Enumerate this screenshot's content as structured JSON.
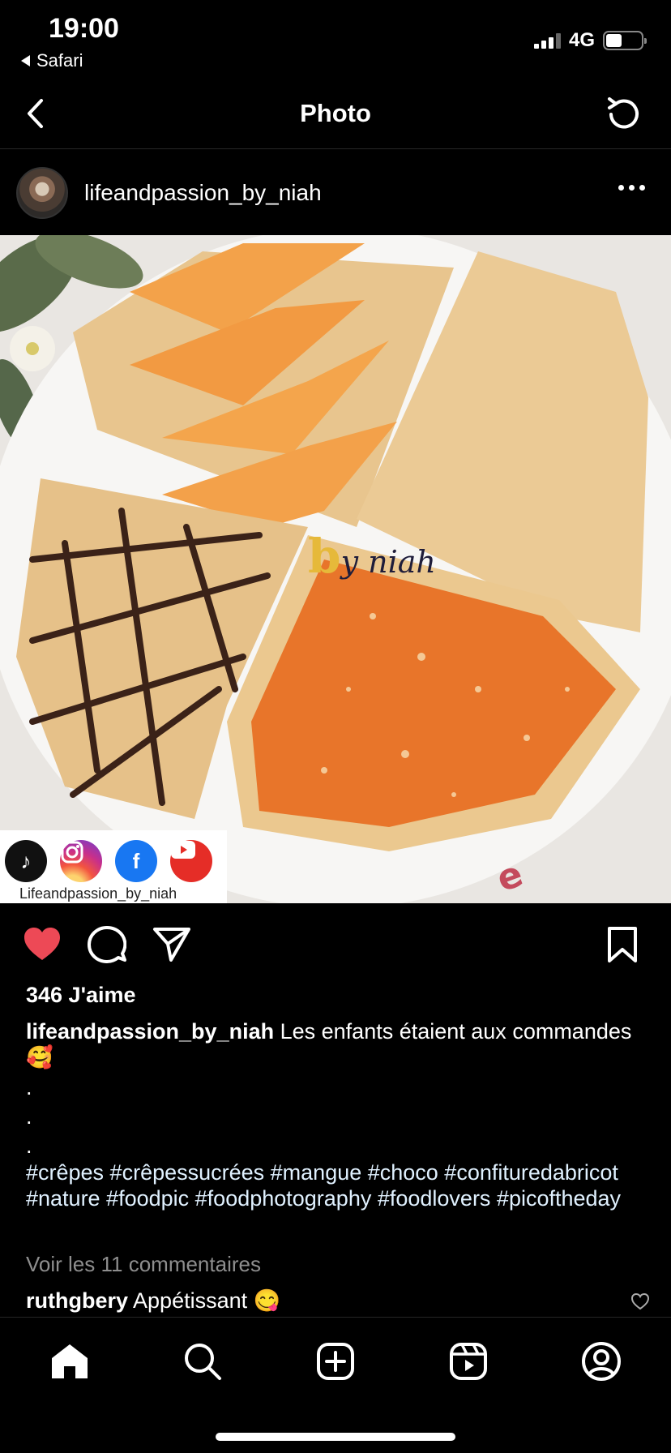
{
  "status_bar": {
    "time": "19:00",
    "back_app": "Safari",
    "network": "4G"
  },
  "nav": {
    "title": "Photo",
    "back_icon": "chevron-left-icon",
    "refresh_icon": "refresh-icon"
  },
  "post": {
    "username": "lifeandpassion_by_niah",
    "photo": {
      "watermark_text": "y niah",
      "watermark_letter": "b",
      "social_handle": "Lifeandpassion_by_niah",
      "social_icons": [
        "tiktok-icon",
        "instagram-icon",
        "facebook-icon",
        "youtube-icon"
      ]
    },
    "likes": "346 J'aime",
    "caption_text": "Les enfants étaient aux commandes 🥰",
    "caption_dots": [
      ".",
      ".",
      "."
    ],
    "hashtags": "#crêpes #crêpessucrées #mangue #choco #confituredabricot #nature #foodpic #foodphotography #foodlovers #picoftheday",
    "view_comments": "Voir les 11 commentaires",
    "comment": {
      "user": "ruthgbery",
      "text": "Appétissant 😋"
    },
    "liked": true,
    "accent_like_color": "#ed4956"
  },
  "tabbar": {
    "items": [
      "home-icon",
      "search-icon",
      "new-post-icon",
      "reels-icon",
      "profile-icon"
    ]
  }
}
